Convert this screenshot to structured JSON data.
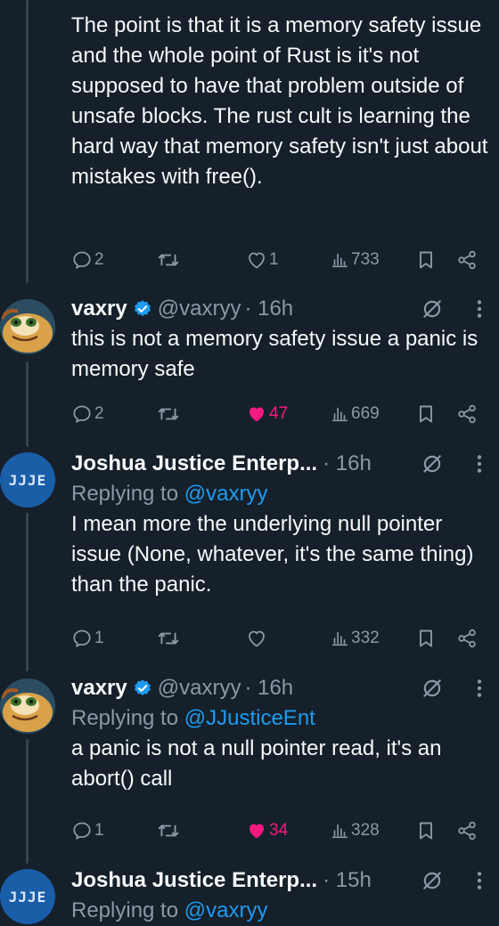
{
  "tweets": [
    {
      "body": "The point is that it is a memory safety issue and the whole point of Rust is it's not supposed to have that problem outside of unsafe blocks. The rust cult is learning the hard way that memory safety isn't just about mistakes with free().",
      "replies": "2",
      "retweets": "",
      "likes": "1",
      "views": "733",
      "liked": false
    },
    {
      "name": "vaxry",
      "handle": "@vaxryy",
      "time": "· 16h",
      "body": "this is not a memory safety issue a panic is memory safe",
      "replies": "2",
      "retweets": "",
      "likes": "47",
      "views": "669",
      "liked": true
    },
    {
      "name": "Joshua Justice Enterp...",
      "handle": "",
      "time": "· 16h",
      "reply_prefix": "Replying to",
      "reply_mention": "@vaxryy",
      "body": "I mean more the underlying null pointer issue (None, whatever, it's the same thing) than the panic.",
      "replies": "1",
      "retweets": "",
      "likes": "",
      "views": "332",
      "liked": false
    },
    {
      "name": "vaxry",
      "handle": "@vaxryy",
      "time": "· 16h",
      "reply_prefix": "Replying to",
      "reply_mention": "@JJusticeEnt",
      "body": "a panic is not a null pointer read, it's an abort() call",
      "replies": "1",
      "retweets": "",
      "likes": "34",
      "views": "328",
      "liked": true
    },
    {
      "name": "Joshua Justice Enterp...",
      "handle": "",
      "time": "· 15h",
      "reply_prefix": "Replying to",
      "reply_mention": "@vaxryy"
    }
  ],
  "avatars": {
    "jj_logo_text": "JJJE"
  },
  "icons": {
    "reply": "reply-icon",
    "retweet": "retweet-icon",
    "like": "heart-icon",
    "views": "views-icon",
    "bookmark": "bookmark-icon",
    "share": "share-icon",
    "grok": "grok-icon",
    "more": "more-icon",
    "verified": "verified-badge-icon"
  },
  "colors": {
    "background": "#15202b",
    "text": "#f7f9f9",
    "muted": "#8b98a5",
    "link": "#1d9bf0",
    "like": "#f91880",
    "thread_line": "#38444d"
  }
}
